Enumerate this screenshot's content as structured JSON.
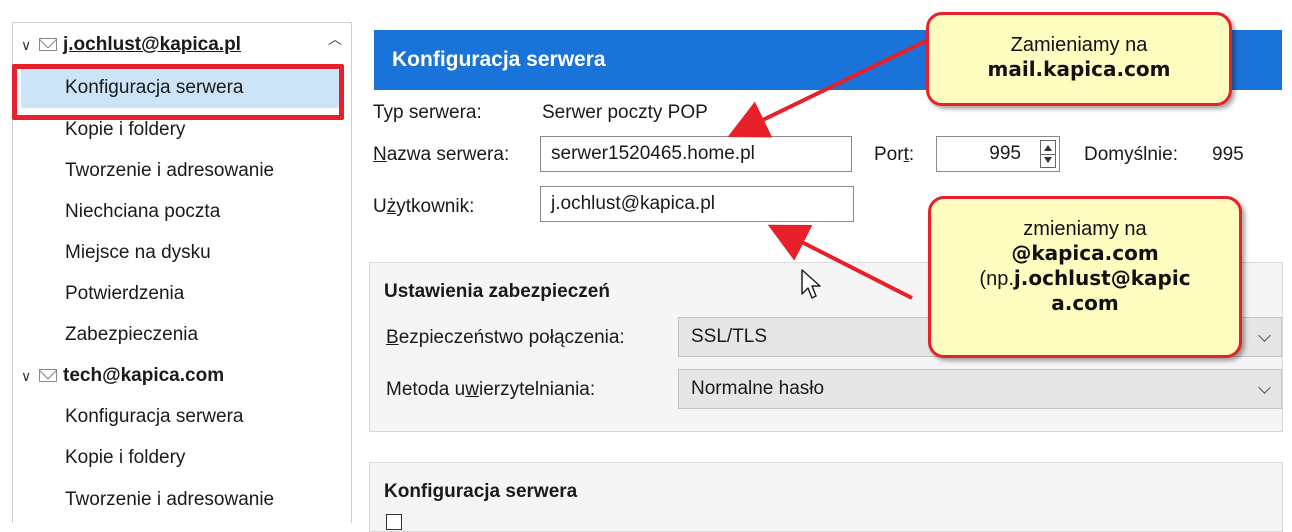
{
  "sidebar": {
    "accounts": [
      {
        "name": "j.ochlust@kapica.pl",
        "items": [
          "Konfiguracja serwera",
          "Kopie i foldery",
          "Tworzenie i adresowanie",
          "Niechciana poczta",
          "Miejsce na dysku",
          "Potwierdzenia",
          "Zabezpieczenia"
        ]
      },
      {
        "name": "tech@kapica.com",
        "items": [
          "Konfiguracja serwera",
          "Kopie i foldery",
          "Tworzenie i adresowanie"
        ]
      }
    ],
    "selected": "Konfiguracja serwera"
  },
  "main": {
    "header": "Konfiguracja serwera",
    "server_type_label": "Typ serwera:",
    "server_type_value": "Serwer poczty POP",
    "server_name_label_pre": "",
    "server_name_label_u": "N",
    "server_name_label_post": "azwa serwera:",
    "server_name_value": "serwer1520465.home.pl",
    "port_label_pre": "Por",
    "port_label_u": "t",
    "port_label_post": ":",
    "port_value": "995",
    "default_label": "Domyślnie:",
    "default_value": "995",
    "user_label_pre": "U",
    "user_label_u": "ż",
    "user_label_post": "ytkownik:",
    "user_value": "j.ochlust@kapica.pl",
    "security_group": {
      "title": "Ustawienia zabezpieczeń",
      "conn_label_pre": "",
      "conn_label_u": "B",
      "conn_label_post": "ezpieczeństwo połączenia:",
      "conn_value": "SSL/TLS",
      "auth_label_pre": "Metoda u",
      "auth_label_u": "w",
      "auth_label_post": "ierzytelniania:",
      "auth_value": "Normalne hasło"
    },
    "server_group": {
      "title": "Konfiguracja serwera"
    }
  },
  "callouts": {
    "top_line1": "Zamieniamy na",
    "top_line2": "mail.kapica.com",
    "bottom_line1": "zmieniamy na",
    "bottom_line2": "@kapica.com",
    "bottom_line3_pre": "(np.",
    "bottom_line3_bold": "j.ochlust@kapic",
    "bottom_line4": "a.com"
  },
  "colors": {
    "header_blue": "#1a73d8",
    "highlight_red": "#e8202a",
    "callout_yellow": "#fffcc0",
    "selected_bg": "#cce4f7"
  }
}
